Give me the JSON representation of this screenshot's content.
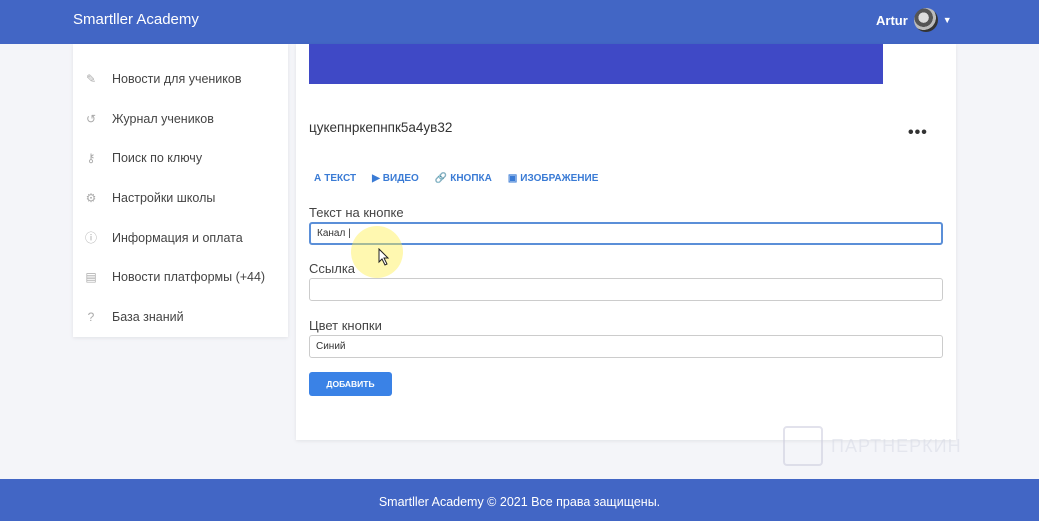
{
  "header": {
    "brand": "Smartller Academy",
    "user_name": "Artur"
  },
  "sidebar": {
    "items": [
      {
        "label": "Новости для учеников",
        "icon": "pencil-icon"
      },
      {
        "label": "Журнал учеников",
        "icon": "history-icon"
      },
      {
        "label": "Поиск по ключу",
        "icon": "key-icon"
      },
      {
        "label": "Настройки школы",
        "icon": "gear-icon"
      },
      {
        "label": "Информация и оплата",
        "icon": "info-icon"
      },
      {
        "label": "Новости платформы (+44)",
        "icon": "news-icon"
      },
      {
        "label": "База знаний",
        "icon": "help-icon"
      }
    ]
  },
  "main": {
    "post_title": "цукепнркепнпк5а4ув32",
    "more_label": "•••",
    "tabs": [
      {
        "label": "ТЕКСТ",
        "icon": "text-icon"
      },
      {
        "label": "ВИДЕО",
        "icon": "youtube-icon"
      },
      {
        "label": "КНОПКА",
        "icon": "link-icon"
      },
      {
        "label": "ИЗОБРАЖЕНИЕ",
        "icon": "image-icon"
      }
    ],
    "button_text_label": "Текст на кнопке",
    "button_text_value": "Канал |",
    "link_label": "Ссылка",
    "link_value": "",
    "color_label": "Цвет кнопки",
    "color_value": "Синий",
    "add_label": "ДОБАВИТЬ"
  },
  "footer": {
    "text": "Smartller Academy © 2021 Все права защищены."
  },
  "watermark": {
    "text": "ПАРТНЕРКИН"
  },
  "colors": {
    "header": "#4266c5",
    "banner": "#3f49c6",
    "accent": "#3a82e6"
  }
}
